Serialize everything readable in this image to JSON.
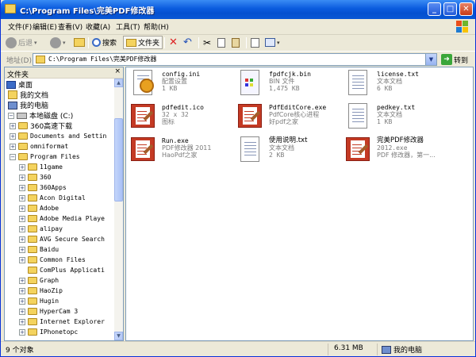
{
  "window": {
    "title": "C:\\Program Files\\完美PDF修改器",
    "controls": {
      "minimize": "_",
      "maximize": "□",
      "close": "✕"
    }
  },
  "menu": [
    "文件(F)",
    "编辑(E)",
    "查看(V)",
    "收藏(A)",
    "工具(T)",
    "帮助(H)"
  ],
  "toolbar": {
    "back": "后退",
    "search": "搜索",
    "folders": "文件夹"
  },
  "address": {
    "label": "地址(D)",
    "value": "C:\\Program Files\\完美PDF修改器",
    "go": "转到"
  },
  "folder_pane": {
    "title": "文件夹",
    "close": "×",
    "items": [
      {
        "label": "桌面",
        "level": 0,
        "expander": ""
      },
      {
        "label": "我的文档",
        "level": 1,
        "expander": ""
      },
      {
        "label": "我的电脑",
        "level": 1,
        "expander": ""
      },
      {
        "label": "本地磁盘 (C:)",
        "level": 2,
        "expander": "−"
      },
      {
        "label": "360高速下载",
        "level": 3,
        "expander": "+"
      },
      {
        "label": "Documents and Settin",
        "level": 3,
        "expander": "+"
      },
      {
        "label": "omniformat",
        "level": 3,
        "expander": "+"
      },
      {
        "label": "Program Files",
        "level": 3,
        "expander": "−"
      },
      {
        "label": "11game",
        "level": 4,
        "expander": "+"
      },
      {
        "label": "360",
        "level": 4,
        "expander": "+"
      },
      {
        "label": "360Apps",
        "level": 4,
        "expander": "+"
      },
      {
        "label": "Acon Digital",
        "level": 4,
        "expander": "+"
      },
      {
        "label": "Adobe",
        "level": 4,
        "expander": "+"
      },
      {
        "label": "Adobe Media Playe",
        "level": 4,
        "expander": "+"
      },
      {
        "label": "alipay",
        "level": 4,
        "expander": "+"
      },
      {
        "label": "AVG Secure Search",
        "level": 4,
        "expander": "+"
      },
      {
        "label": "Baidu",
        "level": 4,
        "expander": "+"
      },
      {
        "label": "Common Files",
        "level": 4,
        "expander": "+"
      },
      {
        "label": "ComPlus Applicati",
        "level": 4,
        "expander": ""
      },
      {
        "label": "Graph",
        "level": 4,
        "expander": "+"
      },
      {
        "label": "HaoZip",
        "level": 4,
        "expander": "+"
      },
      {
        "label": "Hugin",
        "level": 4,
        "expander": "+"
      },
      {
        "label": "HyperCam 3",
        "level": 4,
        "expander": "+"
      },
      {
        "label": "Internet Explorer",
        "level": 4,
        "expander": "+"
      },
      {
        "label": "IPhonetopc",
        "level": 4,
        "expander": "+"
      }
    ]
  },
  "files": [
    {
      "name": "config.ini",
      "line2": "配置设置",
      "line3": "1 KB",
      "icon": "gear-file-icon"
    },
    {
      "name": "fpdfcjk.bin",
      "line2": "BIN 文件",
      "line3": "1,475 KB",
      "icon": "bin-file-icon"
    },
    {
      "name": "license.txt",
      "line2": "文本文档",
      "line3": "6 KB",
      "icon": "text-file-icon"
    },
    {
      "name": "pdfedit.ico",
      "line2": "32 x 32",
      "line3": "图标",
      "icon": "pdf-editor-icon"
    },
    {
      "name": "PdfEditCore.exe",
      "line2": "PdfCore核心进程",
      "line3": "好pdf之家",
      "icon": "pdf-editor-icon"
    },
    {
      "name": "pedkey.txt",
      "line2": "文本文档",
      "line3": "1 KB",
      "icon": "text-file-icon"
    },
    {
      "name": "Run.exe",
      "line2": "PDF修改器 2011",
      "line3": "HaoPdf之家",
      "icon": "pdf-editor-icon"
    },
    {
      "name": "使用说明.txt",
      "line2": "文本文档",
      "line3": "2 KB",
      "icon": "text-file-icon"
    },
    {
      "name": "完美PDF修改器",
      "line2": "2012.exe",
      "line3": "PDF 修改器，第一...",
      "icon": "pdf-editor-icon"
    }
  ],
  "status": {
    "count": "9 个对象",
    "size": "6.31 MB",
    "location": "我的电脑"
  }
}
